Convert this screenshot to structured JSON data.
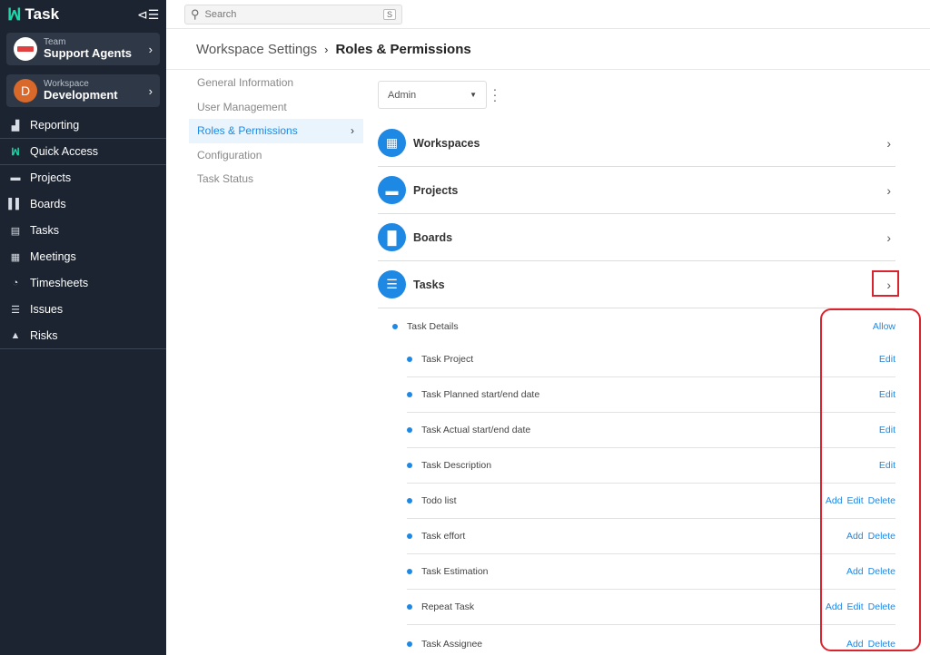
{
  "app": {
    "name": "Task"
  },
  "switchers": [
    {
      "kind": "Team",
      "name": "Support Agents"
    },
    {
      "kind": "Workspace",
      "name": "Development",
      "initial": "D"
    }
  ],
  "nav": [
    {
      "label": "Reporting",
      "icon": "chart-icon"
    },
    {
      "label": "Quick Access",
      "icon": "quick-access-icon"
    },
    {
      "label": "Projects",
      "icon": "folder-icon"
    },
    {
      "label": "Boards",
      "icon": "board-icon"
    },
    {
      "label": "Tasks",
      "icon": "clipboard-icon"
    },
    {
      "label": "Meetings",
      "icon": "calendar-icon"
    },
    {
      "label": "Timesheets",
      "icon": "stopwatch-icon"
    },
    {
      "label": "Issues",
      "icon": "list-icon"
    },
    {
      "label": "Risks",
      "icon": "warning-icon"
    }
  ],
  "search": {
    "placeholder": "Search",
    "shortcut": "S"
  },
  "breadcrumb": {
    "parent": "Workspace Settings",
    "current": "Roles & Permissions"
  },
  "settings_menu": [
    {
      "label": "General Information"
    },
    {
      "label": "User Management"
    },
    {
      "label": "Roles & Permissions",
      "active": true
    },
    {
      "label": "Configuration"
    },
    {
      "label": "Task Status"
    }
  ],
  "role_select": {
    "value": "Admin"
  },
  "sections": [
    {
      "title": "Workspaces",
      "icon": "grid-icon"
    },
    {
      "title": "Projects",
      "icon": "folder-icon"
    },
    {
      "title": "Boards",
      "icon": "board-icon"
    },
    {
      "title": "Tasks",
      "icon": "tasks-icon"
    }
  ],
  "permissions": [
    {
      "label": "Task Details",
      "actions": [
        "Allow"
      ],
      "level": 0
    },
    {
      "label": "Task Project",
      "actions": [
        "Edit"
      ],
      "level": 1
    },
    {
      "label": "Task Planned start/end date",
      "actions": [
        "Edit"
      ],
      "level": 1
    },
    {
      "label": "Task Actual start/end date",
      "actions": [
        "Edit"
      ],
      "level": 1
    },
    {
      "label": "Task Description",
      "actions": [
        "Edit"
      ],
      "level": 1
    },
    {
      "label": "Todo list",
      "actions": [
        "Add",
        "Edit",
        "Delete"
      ],
      "level": 1
    },
    {
      "label": "Task effort",
      "actions": [
        "Add",
        "Delete"
      ],
      "level": 1
    },
    {
      "label": "Task Estimation",
      "actions": [
        "Add",
        "Delete"
      ],
      "level": 1
    },
    {
      "label": "Repeat Task",
      "actions": [
        "Add",
        "Edit",
        "Delete"
      ],
      "level": 1
    },
    {
      "label": "Task Assignee",
      "actions": [
        "Add",
        "Delete"
      ],
      "level": 1
    }
  ],
  "colors": {
    "accent": "#1e88e5",
    "sidebar": "#1b2430",
    "highlight": "#d9232e",
    "brand": "#1fd4a8"
  }
}
